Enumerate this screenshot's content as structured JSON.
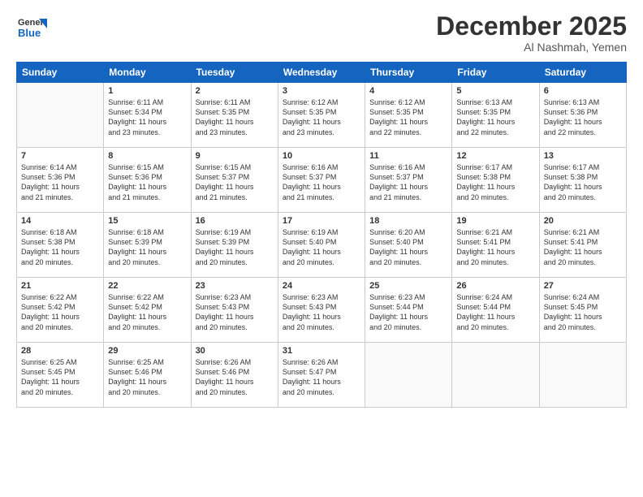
{
  "logo": {
    "general": "General",
    "blue": "Blue"
  },
  "header": {
    "month": "December 2025",
    "location": "Al Nashmah, Yemen"
  },
  "days": [
    "Sunday",
    "Monday",
    "Tuesday",
    "Wednesday",
    "Thursday",
    "Friday",
    "Saturday"
  ],
  "weeks": [
    [
      {
        "day": "",
        "sunrise": "",
        "sunset": "",
        "daylight": ""
      },
      {
        "day": "1",
        "sunrise": "6:11 AM",
        "sunset": "5:34 PM",
        "daylight": "11 hours and 23 minutes."
      },
      {
        "day": "2",
        "sunrise": "6:11 AM",
        "sunset": "5:35 PM",
        "daylight": "11 hours and 23 minutes."
      },
      {
        "day": "3",
        "sunrise": "6:12 AM",
        "sunset": "5:35 PM",
        "daylight": "11 hours and 23 minutes."
      },
      {
        "day": "4",
        "sunrise": "6:12 AM",
        "sunset": "5:35 PM",
        "daylight": "11 hours and 22 minutes."
      },
      {
        "day": "5",
        "sunrise": "6:13 AM",
        "sunset": "5:35 PM",
        "daylight": "11 hours and 22 minutes."
      },
      {
        "day": "6",
        "sunrise": "6:13 AM",
        "sunset": "5:36 PM",
        "daylight": "11 hours and 22 minutes."
      }
    ],
    [
      {
        "day": "7",
        "sunrise": "6:14 AM",
        "sunset": "5:36 PM",
        "daylight": "11 hours and 21 minutes."
      },
      {
        "day": "8",
        "sunrise": "6:15 AM",
        "sunset": "5:36 PM",
        "daylight": "11 hours and 21 minutes."
      },
      {
        "day": "9",
        "sunrise": "6:15 AM",
        "sunset": "5:37 PM",
        "daylight": "11 hours and 21 minutes."
      },
      {
        "day": "10",
        "sunrise": "6:16 AM",
        "sunset": "5:37 PM",
        "daylight": "11 hours and 21 minutes."
      },
      {
        "day": "11",
        "sunrise": "6:16 AM",
        "sunset": "5:37 PM",
        "daylight": "11 hours and 21 minutes."
      },
      {
        "day": "12",
        "sunrise": "6:17 AM",
        "sunset": "5:38 PM",
        "daylight": "11 hours and 20 minutes."
      },
      {
        "day": "13",
        "sunrise": "6:17 AM",
        "sunset": "5:38 PM",
        "daylight": "11 hours and 20 minutes."
      }
    ],
    [
      {
        "day": "14",
        "sunrise": "6:18 AM",
        "sunset": "5:38 PM",
        "daylight": "11 hours and 20 minutes."
      },
      {
        "day": "15",
        "sunrise": "6:18 AM",
        "sunset": "5:39 PM",
        "daylight": "11 hours and 20 minutes."
      },
      {
        "day": "16",
        "sunrise": "6:19 AM",
        "sunset": "5:39 PM",
        "daylight": "11 hours and 20 minutes."
      },
      {
        "day": "17",
        "sunrise": "6:19 AM",
        "sunset": "5:40 PM",
        "daylight": "11 hours and 20 minutes."
      },
      {
        "day": "18",
        "sunrise": "6:20 AM",
        "sunset": "5:40 PM",
        "daylight": "11 hours and 20 minutes."
      },
      {
        "day": "19",
        "sunrise": "6:21 AM",
        "sunset": "5:41 PM",
        "daylight": "11 hours and 20 minutes."
      },
      {
        "day": "20",
        "sunrise": "6:21 AM",
        "sunset": "5:41 PM",
        "daylight": "11 hours and 20 minutes."
      }
    ],
    [
      {
        "day": "21",
        "sunrise": "6:22 AM",
        "sunset": "5:42 PM",
        "daylight": "11 hours and 20 minutes."
      },
      {
        "day": "22",
        "sunrise": "6:22 AM",
        "sunset": "5:42 PM",
        "daylight": "11 hours and 20 minutes."
      },
      {
        "day": "23",
        "sunrise": "6:23 AM",
        "sunset": "5:43 PM",
        "daylight": "11 hours and 20 minutes."
      },
      {
        "day": "24",
        "sunrise": "6:23 AM",
        "sunset": "5:43 PM",
        "daylight": "11 hours and 20 minutes."
      },
      {
        "day": "25",
        "sunrise": "6:23 AM",
        "sunset": "5:44 PM",
        "daylight": "11 hours and 20 minutes."
      },
      {
        "day": "26",
        "sunrise": "6:24 AM",
        "sunset": "5:44 PM",
        "daylight": "11 hours and 20 minutes."
      },
      {
        "day": "27",
        "sunrise": "6:24 AM",
        "sunset": "5:45 PM",
        "daylight": "11 hours and 20 minutes."
      }
    ],
    [
      {
        "day": "28",
        "sunrise": "6:25 AM",
        "sunset": "5:45 PM",
        "daylight": "11 hours and 20 minutes."
      },
      {
        "day": "29",
        "sunrise": "6:25 AM",
        "sunset": "5:46 PM",
        "daylight": "11 hours and 20 minutes."
      },
      {
        "day": "30",
        "sunrise": "6:26 AM",
        "sunset": "5:46 PM",
        "daylight": "11 hours and 20 minutes."
      },
      {
        "day": "31",
        "sunrise": "6:26 AM",
        "sunset": "5:47 PM",
        "daylight": "11 hours and 20 minutes."
      },
      {
        "day": "",
        "sunrise": "",
        "sunset": "",
        "daylight": ""
      },
      {
        "day": "",
        "sunrise": "",
        "sunset": "",
        "daylight": ""
      },
      {
        "day": "",
        "sunrise": "",
        "sunset": "",
        "daylight": ""
      }
    ]
  ],
  "labels": {
    "sunrise": "Sunrise:",
    "sunset": "Sunset:",
    "daylight": "Daylight:"
  }
}
